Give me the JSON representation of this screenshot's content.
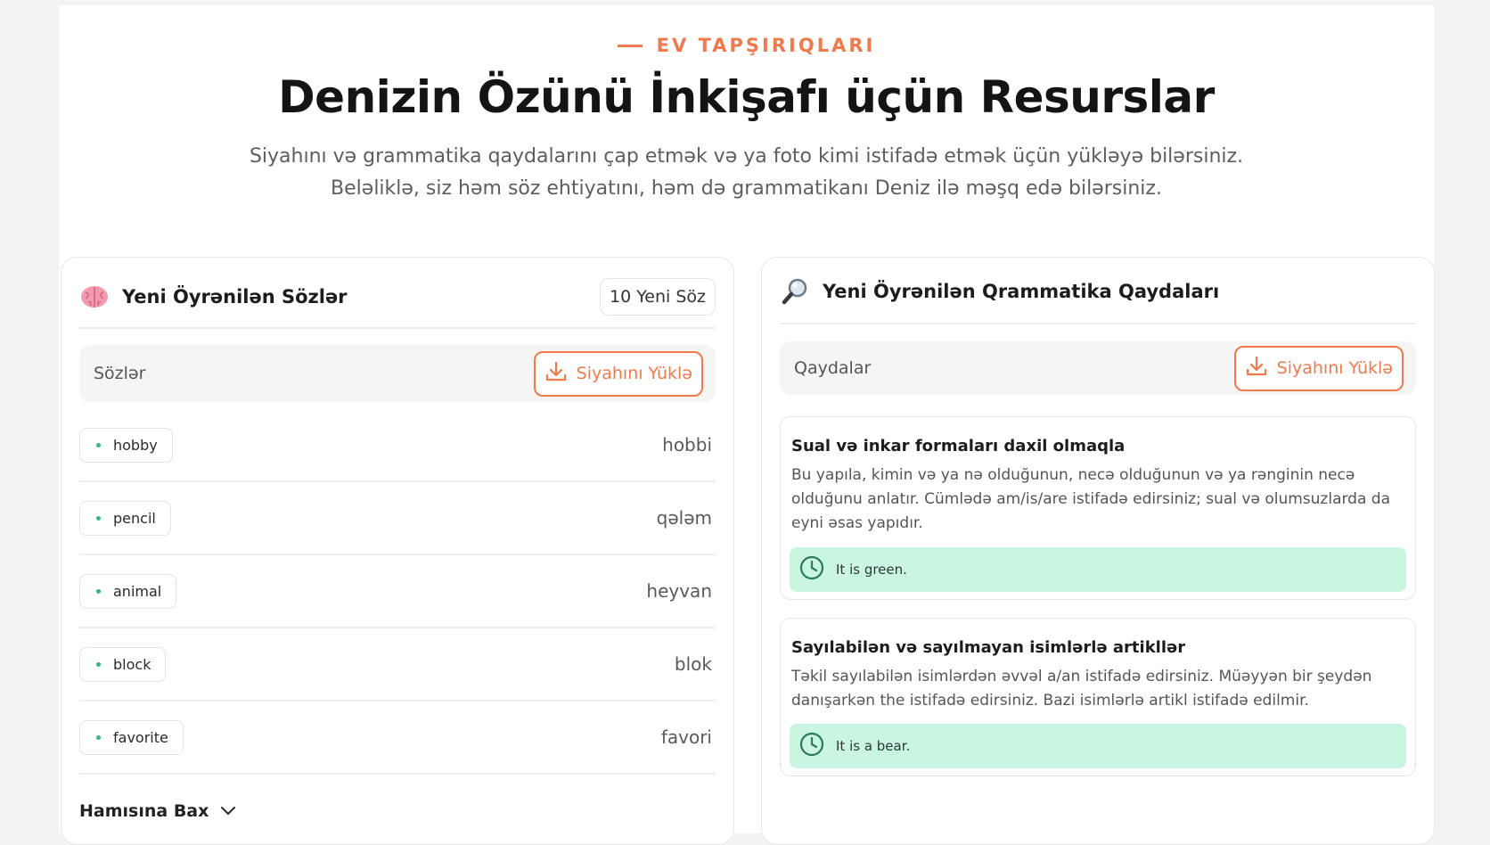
{
  "header": {
    "eyebrow": "EV TAPŞIRIQLARI",
    "title": "Denizin Özünü İnkişafı üçün Resurslar",
    "subtitle_line1": "Siyahını və grammatika qaydalarını çap etmək və ya foto kimi istifadə etmək üçün yükləyə bilərsiniz.",
    "subtitle_line2": "Beləliklə, siz həm söz ehtiyatını, həm də grammatikanı Deniz ilə məşq edə bilərsiniz."
  },
  "words_card": {
    "icon": "brain-icon",
    "title": "Yeni Öyrənilən Sözlər",
    "count_badge": "10 Yeni Söz",
    "section_label": "Sözlər",
    "download_label": "Siyahını Yüklə",
    "words": [
      {
        "en": "hobby",
        "az": "hobbi"
      },
      {
        "en": "pencil",
        "az": "qələm"
      },
      {
        "en": "animal",
        "az": "heyvan"
      },
      {
        "en": "block",
        "az": "blok"
      },
      {
        "en": "favorite",
        "az": "favori"
      }
    ],
    "see_all": "Hamısına Bax"
  },
  "grammar_card": {
    "icon": "magnifier-icon",
    "title": "Yeni Öyrənilən Qrammatika Qaydaları",
    "section_label": "Qaydalar",
    "download_label": "Siyahını Yüklə",
    "rules": [
      {
        "title": "Sual və inkar formaları daxil olmaqla",
        "description": "Bu yapıla, kimin və ya nə olduğunun, necə olduğunun və ya rənginin necə olduğunu anlatır. Cümlədə am/is/are istifadə edirsiniz; sual və olumsuzlarda da eyni əsas yapıdır.",
        "example": "It is green."
      },
      {
        "title": "Sayılabilən və sayılmayan isimlərlə artikllər",
        "description": "Təkil sayılabilən isimlərdən əvvəl a/an istifadə edirsiniz. Müəyyən bir şeydən danışarkən the istifadə edirsiniz. Bazi isimlərlə artikl istifadə edilmir.",
        "example": "It is a bear."
      }
    ]
  },
  "colors": {
    "accent": "#f07a4c",
    "example_bg": "#caf5e3",
    "example_icon": "#2a7a5a",
    "chip_dot": "#35b58a"
  }
}
